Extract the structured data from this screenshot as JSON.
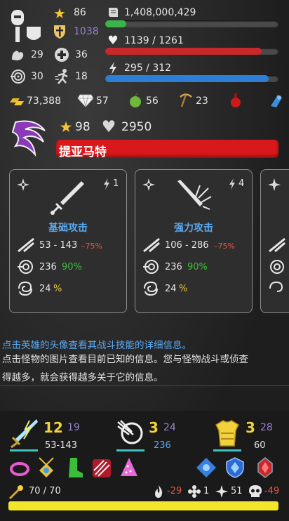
{
  "hero": {
    "stars": "86",
    "shield_value": "1038",
    "strength": "29",
    "health_bonus": "36",
    "accuracy": "30",
    "speed": "18",
    "xp_value": "1,408,000,429",
    "xp_fraction": 0.12,
    "hp_text": "1139 / 1261",
    "hp_fraction": 0.903,
    "energy_text": "295 / 312",
    "energy_fraction": 0.945
  },
  "resources": [
    {
      "icon": "gold-bars-icon",
      "value": "73,388"
    },
    {
      "icon": "diamond-icon",
      "value": "57"
    },
    {
      "icon": "apple-icon",
      "value": "56"
    },
    {
      "icon": "pickaxe-icon",
      "value": "23"
    },
    {
      "icon": "red-potion-icon",
      "value": ""
    },
    {
      "icon": "blue-flask-icon",
      "value": ""
    }
  ],
  "monster": {
    "stars": "98",
    "hp": "2950",
    "name": "提亚马特"
  },
  "skills": [
    {
      "energy": "1",
      "name": "基础攻击",
      "damage": "53 - 143",
      "damage_mod": "–75%",
      "accuracy": "236",
      "accuracy_pct": "90%",
      "crit": "24",
      "crit_pct": "%"
    },
    {
      "energy": "4",
      "name": "强力攻击",
      "damage": "106 - 286",
      "damage_mod": "–75%",
      "accuracy": "236",
      "accuracy_pct": "90%",
      "crit": "24",
      "crit_pct": "%"
    }
  ],
  "info": {
    "line1": "点击英雄的头像查看其战斗技能的详细信息。",
    "line2": "点击怪物的图片查看目前已知的信息。您与怪物战斗或侦查",
    "line3": "得越多，就会获得越多关于它的信息。"
  },
  "bottom": {
    "weapon_level": "12",
    "weapon_level2": "19",
    "weapon_damage": "53-143",
    "accuracy_level": "3",
    "accuracy_level2": "24",
    "accuracy_value": "236",
    "armor_level": "3",
    "armor_level2": "28",
    "armor_value": "60",
    "staff_text": "70 / 70",
    "fire_value": "-29",
    "frost_value": "1",
    "shuriken_value": "51",
    "skull_value": "-49"
  },
  "colors": {
    "xp": "#39b54a",
    "hp": "#c8282a",
    "energy": "#2d7fd6",
    "monster_name_bg": "#d9181c",
    "skill_name": "#5aa9f2",
    "bottom_hp": "#f2e62a"
  }
}
